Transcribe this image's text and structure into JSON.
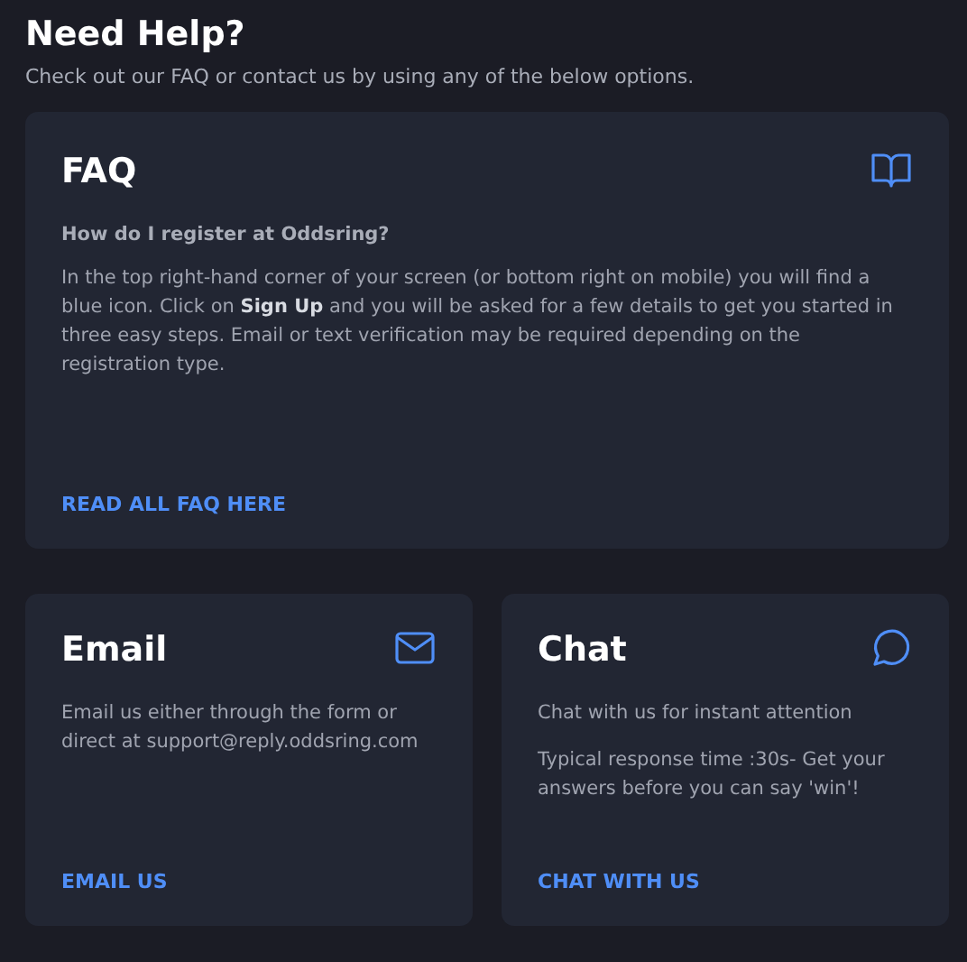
{
  "header": {
    "title": "Need Help?",
    "subtitle": "Check out our FAQ or contact us by using any of the below options."
  },
  "faq": {
    "title": "FAQ",
    "kind": "book",
    "question": "How do I register at Oddsring?",
    "answer": "In the top right-hand corner of your screen (or bottom right on mobile) you will find a blue icon. Click on **Sign Up** and you will be asked for a few details to get you started in three easy steps. Email or text verification may be required depending on the registration type.",
    "link": "READ ALL FAQ HERE"
  },
  "contacts": [
    {
      "title": "Email",
      "kind": "mail",
      "paragraphs": [
        "Email us either through the form or direct at support@reply.oddsring.com"
      ],
      "link": "EMAIL US"
    },
    {
      "title": "Chat",
      "kind": "chat",
      "paragraphs": [
        "Chat with us for instant attention",
        "Typical response time :30s- Get your answers before you can say 'win'!"
      ],
      "link": "CHAT WITH US"
    }
  ]
}
